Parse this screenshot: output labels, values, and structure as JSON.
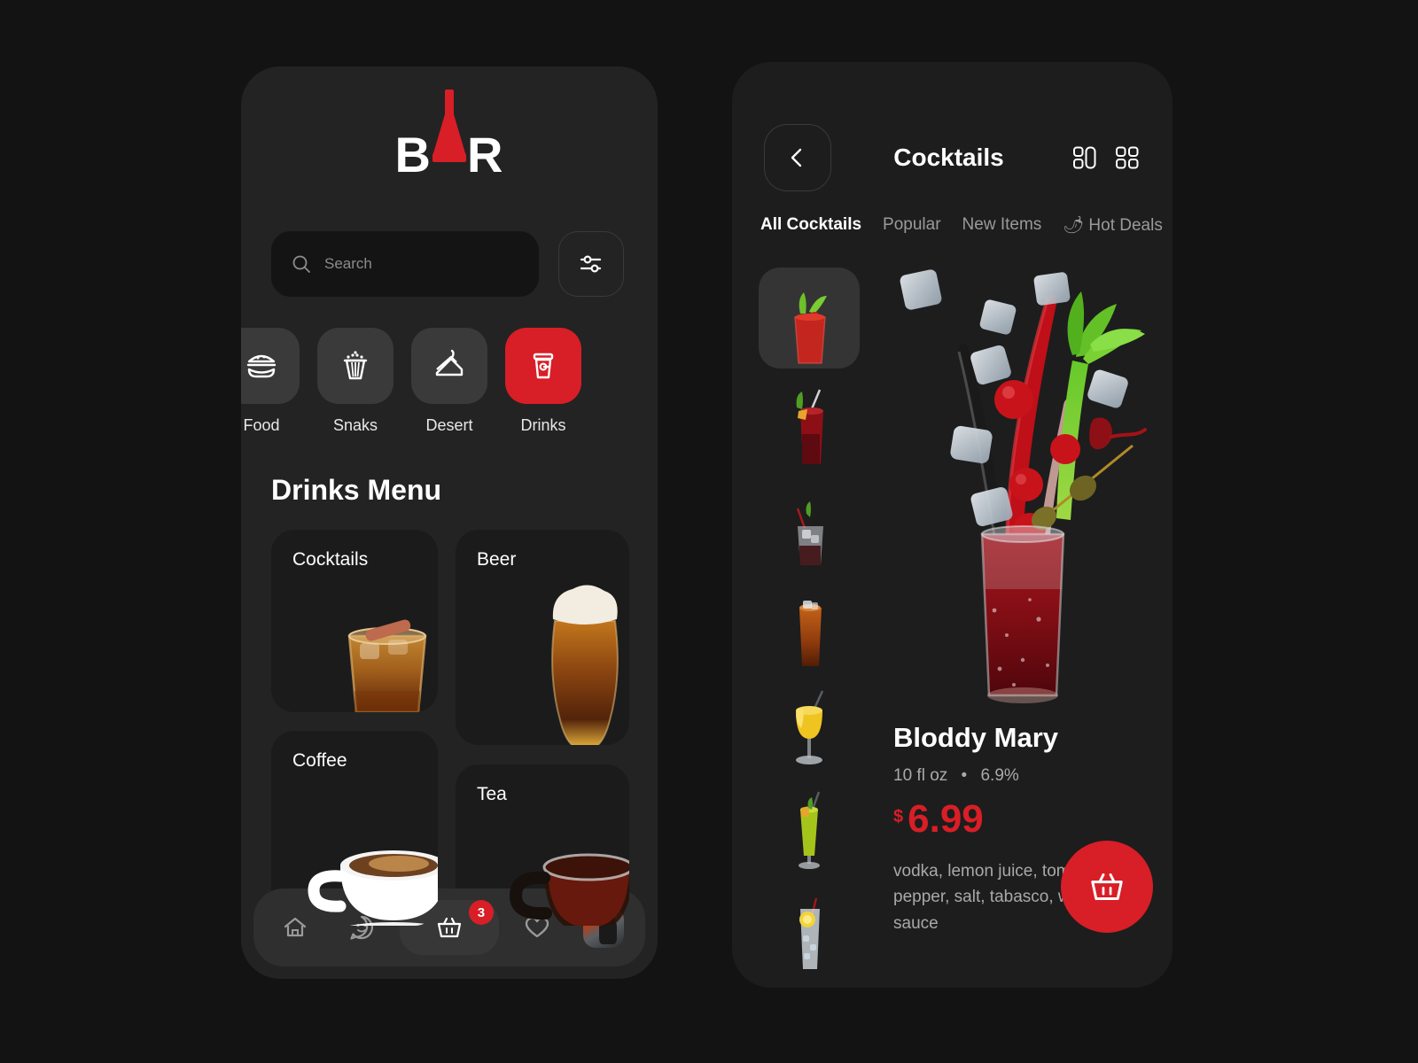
{
  "theme": {
    "bg": "#131313",
    "phone_bg": "#232323",
    "accent_red": "#d81e26",
    "card_bg": "#1b1b1b",
    "text_primary": "#ffffff",
    "text_muted": "#a9a9a9"
  },
  "left_screen": {
    "logo": {
      "text": "BAR",
      "letter_1": "B",
      "letter_2": "A",
      "letter_3": "R",
      "icon": "bottle-icon"
    },
    "search": {
      "placeholder": "Search",
      "value": "",
      "icon": "search-icon"
    },
    "filter_button": {
      "icon": "sliders-icon",
      "label": "Filters"
    },
    "categories": [
      {
        "label": "Food",
        "icon": "burger-icon",
        "active": false
      },
      {
        "label": "Snaks",
        "icon": "popcorn-icon",
        "active": false
      },
      {
        "label": "Desert",
        "icon": "cake-icon",
        "active": false
      },
      {
        "label": "Drinks",
        "icon": "cup-icon",
        "active": true
      }
    ],
    "section_title": "Drinks Menu",
    "menu_cards": [
      {
        "title": "Cocktails",
        "image": "whiskey-glass-photo"
      },
      {
        "title": "Beer",
        "image": "beer-glass-photo"
      },
      {
        "title": "Coffee",
        "image": "coffee-cup-photo"
      },
      {
        "title": "Tea",
        "image": "tea-cup-photo"
      }
    ],
    "bottom_nav": [
      {
        "name": "home",
        "icon": "home-icon",
        "active": false,
        "badge": ""
      },
      {
        "name": "chat",
        "icon": "smiley-icon",
        "active": false,
        "badge": ""
      },
      {
        "name": "cart",
        "icon": "basket-icon",
        "active": true,
        "badge": "3"
      },
      {
        "name": "favorites",
        "icon": "heart-icon",
        "active": false,
        "badge": ""
      },
      {
        "name": "profile",
        "icon": "avatar-image",
        "active": false,
        "badge": ""
      }
    ]
  },
  "right_screen": {
    "back_button": {
      "icon": "chevron-left-icon",
      "label": "Back"
    },
    "title": "Cocktails",
    "view_toggles": [
      {
        "name": "layout-view",
        "icon": "layout-view-icon",
        "active": true
      },
      {
        "name": "grid-view",
        "icon": "grid-view-icon",
        "active": false
      }
    ],
    "tabs": [
      {
        "label": "All Cocktails",
        "active": true,
        "emoji": ""
      },
      {
        "label": "Popular",
        "active": false,
        "emoji": ""
      },
      {
        "label": "New Items",
        "active": false,
        "emoji": ""
      },
      {
        "label": "Hot Deals",
        "active": false,
        "emoji": "🌶"
      }
    ],
    "thumbnails": [
      {
        "name": "bloody-mary-thumb",
        "selected": true
      },
      {
        "name": "red-highball-thumb",
        "selected": false
      },
      {
        "name": "rocks-glass-thumb",
        "selected": false
      },
      {
        "name": "cola-glass-thumb",
        "selected": false
      },
      {
        "name": "yellow-goblet-thumb",
        "selected": false
      },
      {
        "name": "green-tall-thumb",
        "selected": false
      },
      {
        "name": "lemon-soda-thumb",
        "selected": false
      }
    ],
    "hero_image": "bloody-mary-splash-photo",
    "product": {
      "name": "Bloddy Mary",
      "volume": "10 fl oz",
      "separator": "•",
      "abv": "6.9%",
      "currency": "$",
      "price": "6.99",
      "ingredients": "vodka, lemon juice, tomato juice, pepper, salt, tabasco,  worcester sauce"
    },
    "cart_fab": {
      "icon": "basket-icon",
      "label": "Add to cart"
    }
  }
}
